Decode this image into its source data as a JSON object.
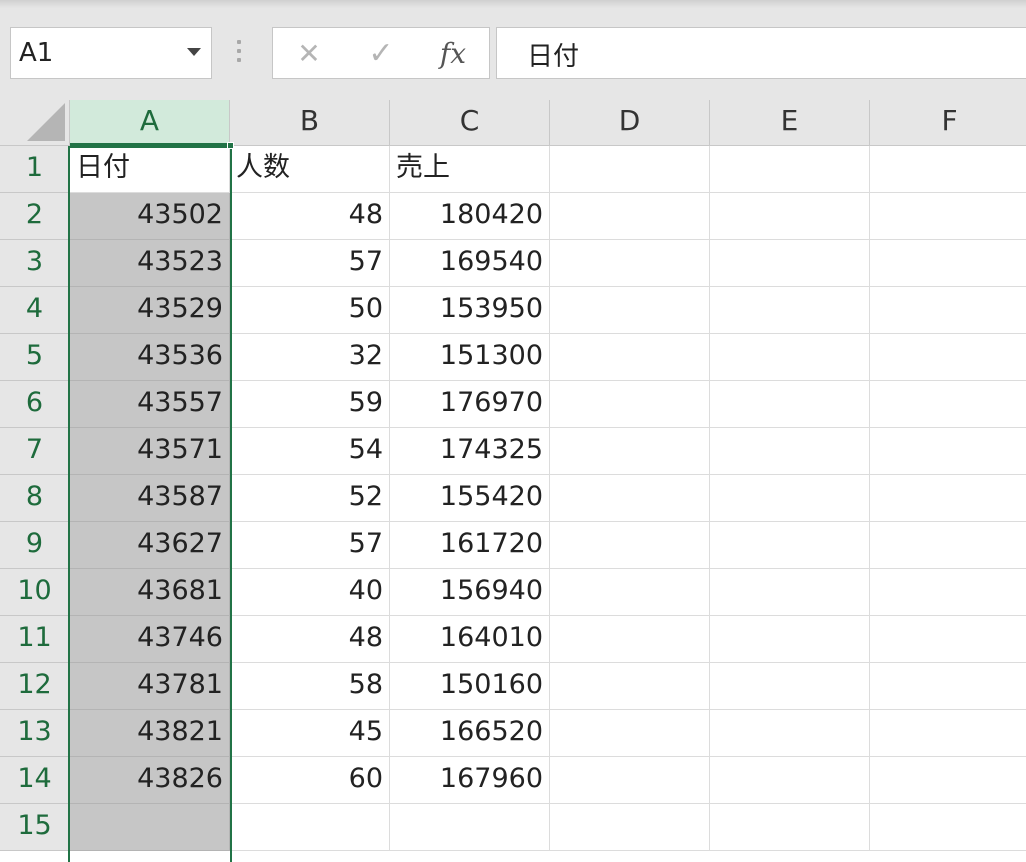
{
  "name_box": {
    "value": "A1"
  },
  "formula_bar": {
    "cancel_glyph": "✕",
    "enter_glyph": "✓",
    "fx_label": "fx",
    "content": "日付"
  },
  "column_headers": [
    "A",
    "B",
    "C",
    "D",
    "E",
    "F"
  ],
  "selected_column": "A",
  "active_cell": "A1",
  "accent_color": "#217346",
  "rows": [
    {
      "n": "1",
      "a": "日付",
      "b": "人数",
      "c": "売上"
    },
    {
      "n": "2",
      "a": "43502",
      "b": "48",
      "c": "180420"
    },
    {
      "n": "3",
      "a": "43523",
      "b": "57",
      "c": "169540"
    },
    {
      "n": "4",
      "a": "43529",
      "b": "50",
      "c": "153950"
    },
    {
      "n": "5",
      "a": "43536",
      "b": "32",
      "c": "151300"
    },
    {
      "n": "6",
      "a": "43557",
      "b": "59",
      "c": "176970"
    },
    {
      "n": "7",
      "a": "43571",
      "b": "54",
      "c": "174325"
    },
    {
      "n": "8",
      "a": "43587",
      "b": "52",
      "c": "155420"
    },
    {
      "n": "9",
      "a": "43627",
      "b": "57",
      "c": "161720"
    },
    {
      "n": "10",
      "a": "43681",
      "b": "40",
      "c": "156940"
    },
    {
      "n": "11",
      "a": "43746",
      "b": "48",
      "c": "164010"
    },
    {
      "n": "12",
      "a": "43781",
      "b": "58",
      "c": "150160"
    },
    {
      "n": "13",
      "a": "43821",
      "b": "45",
      "c": "166520"
    },
    {
      "n": "14",
      "a": "43826",
      "b": "60",
      "c": "167960"
    },
    {
      "n": "15",
      "a": "",
      "b": "",
      "c": ""
    }
  ]
}
